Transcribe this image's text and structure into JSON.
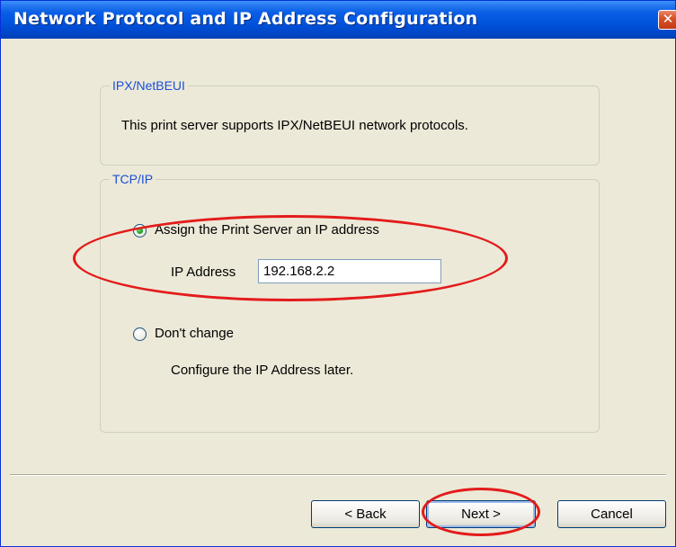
{
  "window": {
    "title": "Network Protocol and IP Address Configuration",
    "close_symbol": "✕"
  },
  "ipx_group": {
    "legend": "IPX/NetBEUI",
    "description": "This print server supports IPX/NetBEUI network protocols."
  },
  "tcp_group": {
    "legend": "TCP/IP",
    "assign_option": {
      "label": "Assign the Print Server an IP address",
      "selected": true
    },
    "ip_address": {
      "label": "IP Address",
      "value": "192.168.2.2"
    },
    "dont_change_option": {
      "label": "Don't change",
      "selected": false
    },
    "dont_change_note": "Configure the IP Address later."
  },
  "buttons": {
    "back": "< Back",
    "next": "Next >",
    "cancel": "Cancel"
  },
  "colors": {
    "titlebar": "#0052DC",
    "window_bg": "#ECE9D8",
    "group_legend": "#1A4FD6",
    "annotation": "#E31B1B"
  }
}
